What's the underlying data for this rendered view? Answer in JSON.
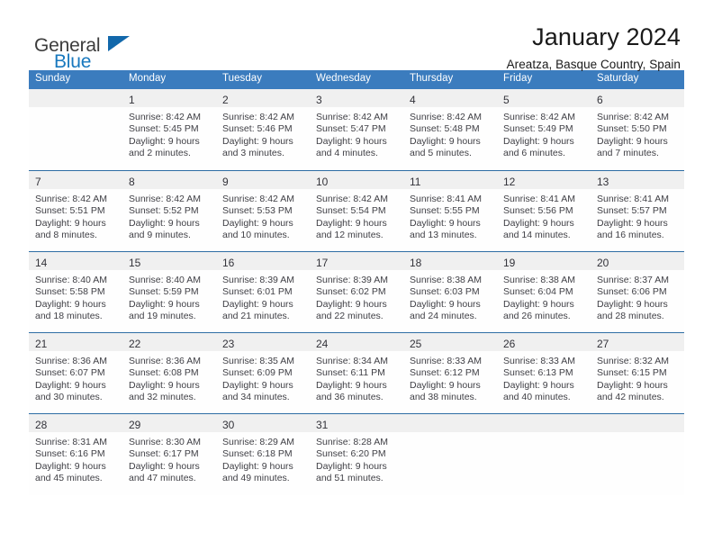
{
  "brand": {
    "name_part1": "General",
    "name_part2": "Blue",
    "accent_color": "#1268ab"
  },
  "header": {
    "title": "January 2024",
    "subtitle": "Areatza, Basque Country, Spain"
  },
  "theme": {
    "header_row_bg": "#3b7cbe",
    "week_divider": "#2e6da4",
    "day_number_band": "#f0f0f0"
  },
  "weekdays": [
    "Sunday",
    "Monday",
    "Tuesday",
    "Wednesday",
    "Thursday",
    "Friday",
    "Saturday"
  ],
  "weeks": [
    [
      {
        "day": "",
        "lines": []
      },
      {
        "day": "1",
        "lines": [
          "Sunrise: 8:42 AM",
          "Sunset: 5:45 PM",
          "Daylight: 9 hours",
          "and 2 minutes."
        ]
      },
      {
        "day": "2",
        "lines": [
          "Sunrise: 8:42 AM",
          "Sunset: 5:46 PM",
          "Daylight: 9 hours",
          "and 3 minutes."
        ]
      },
      {
        "day": "3",
        "lines": [
          "Sunrise: 8:42 AM",
          "Sunset: 5:47 PM",
          "Daylight: 9 hours",
          "and 4 minutes."
        ]
      },
      {
        "day": "4",
        "lines": [
          "Sunrise: 8:42 AM",
          "Sunset: 5:48 PM",
          "Daylight: 9 hours",
          "and 5 minutes."
        ]
      },
      {
        "day": "5",
        "lines": [
          "Sunrise: 8:42 AM",
          "Sunset: 5:49 PM",
          "Daylight: 9 hours",
          "and 6 minutes."
        ]
      },
      {
        "day": "6",
        "lines": [
          "Sunrise: 8:42 AM",
          "Sunset: 5:50 PM",
          "Daylight: 9 hours",
          "and 7 minutes."
        ]
      }
    ],
    [
      {
        "day": "7",
        "lines": [
          "Sunrise: 8:42 AM",
          "Sunset: 5:51 PM",
          "Daylight: 9 hours",
          "and 8 minutes."
        ]
      },
      {
        "day": "8",
        "lines": [
          "Sunrise: 8:42 AM",
          "Sunset: 5:52 PM",
          "Daylight: 9 hours",
          "and 9 minutes."
        ]
      },
      {
        "day": "9",
        "lines": [
          "Sunrise: 8:42 AM",
          "Sunset: 5:53 PM",
          "Daylight: 9 hours",
          "and 10 minutes."
        ]
      },
      {
        "day": "10",
        "lines": [
          "Sunrise: 8:42 AM",
          "Sunset: 5:54 PM",
          "Daylight: 9 hours",
          "and 12 minutes."
        ]
      },
      {
        "day": "11",
        "lines": [
          "Sunrise: 8:41 AM",
          "Sunset: 5:55 PM",
          "Daylight: 9 hours",
          "and 13 minutes."
        ]
      },
      {
        "day": "12",
        "lines": [
          "Sunrise: 8:41 AM",
          "Sunset: 5:56 PM",
          "Daylight: 9 hours",
          "and 14 minutes."
        ]
      },
      {
        "day": "13",
        "lines": [
          "Sunrise: 8:41 AM",
          "Sunset: 5:57 PM",
          "Daylight: 9 hours",
          "and 16 minutes."
        ]
      }
    ],
    [
      {
        "day": "14",
        "lines": [
          "Sunrise: 8:40 AM",
          "Sunset: 5:58 PM",
          "Daylight: 9 hours",
          "and 18 minutes."
        ]
      },
      {
        "day": "15",
        "lines": [
          "Sunrise: 8:40 AM",
          "Sunset: 5:59 PM",
          "Daylight: 9 hours",
          "and 19 minutes."
        ]
      },
      {
        "day": "16",
        "lines": [
          "Sunrise: 8:39 AM",
          "Sunset: 6:01 PM",
          "Daylight: 9 hours",
          "and 21 minutes."
        ]
      },
      {
        "day": "17",
        "lines": [
          "Sunrise: 8:39 AM",
          "Sunset: 6:02 PM",
          "Daylight: 9 hours",
          "and 22 minutes."
        ]
      },
      {
        "day": "18",
        "lines": [
          "Sunrise: 8:38 AM",
          "Sunset: 6:03 PM",
          "Daylight: 9 hours",
          "and 24 minutes."
        ]
      },
      {
        "day": "19",
        "lines": [
          "Sunrise: 8:38 AM",
          "Sunset: 6:04 PM",
          "Daylight: 9 hours",
          "and 26 minutes."
        ]
      },
      {
        "day": "20",
        "lines": [
          "Sunrise: 8:37 AM",
          "Sunset: 6:06 PM",
          "Daylight: 9 hours",
          "and 28 minutes."
        ]
      }
    ],
    [
      {
        "day": "21",
        "lines": [
          "Sunrise: 8:36 AM",
          "Sunset: 6:07 PM",
          "Daylight: 9 hours",
          "and 30 minutes."
        ]
      },
      {
        "day": "22",
        "lines": [
          "Sunrise: 8:36 AM",
          "Sunset: 6:08 PM",
          "Daylight: 9 hours",
          "and 32 minutes."
        ]
      },
      {
        "day": "23",
        "lines": [
          "Sunrise: 8:35 AM",
          "Sunset: 6:09 PM",
          "Daylight: 9 hours",
          "and 34 minutes."
        ]
      },
      {
        "day": "24",
        "lines": [
          "Sunrise: 8:34 AM",
          "Sunset: 6:11 PM",
          "Daylight: 9 hours",
          "and 36 minutes."
        ]
      },
      {
        "day": "25",
        "lines": [
          "Sunrise: 8:33 AM",
          "Sunset: 6:12 PM",
          "Daylight: 9 hours",
          "and 38 minutes."
        ]
      },
      {
        "day": "26",
        "lines": [
          "Sunrise: 8:33 AM",
          "Sunset: 6:13 PM",
          "Daylight: 9 hours",
          "and 40 minutes."
        ]
      },
      {
        "day": "27",
        "lines": [
          "Sunrise: 8:32 AM",
          "Sunset: 6:15 PM",
          "Daylight: 9 hours",
          "and 42 minutes."
        ]
      }
    ],
    [
      {
        "day": "28",
        "lines": [
          "Sunrise: 8:31 AM",
          "Sunset: 6:16 PM",
          "Daylight: 9 hours",
          "and 45 minutes."
        ]
      },
      {
        "day": "29",
        "lines": [
          "Sunrise: 8:30 AM",
          "Sunset: 6:17 PM",
          "Daylight: 9 hours",
          "and 47 minutes."
        ]
      },
      {
        "day": "30",
        "lines": [
          "Sunrise: 8:29 AM",
          "Sunset: 6:18 PM",
          "Daylight: 9 hours",
          "and 49 minutes."
        ]
      },
      {
        "day": "31",
        "lines": [
          "Sunrise: 8:28 AM",
          "Sunset: 6:20 PM",
          "Daylight: 9 hours",
          "and 51 minutes."
        ]
      },
      {
        "day": "",
        "lines": []
      },
      {
        "day": "",
        "lines": []
      },
      {
        "day": "",
        "lines": []
      }
    ]
  ]
}
